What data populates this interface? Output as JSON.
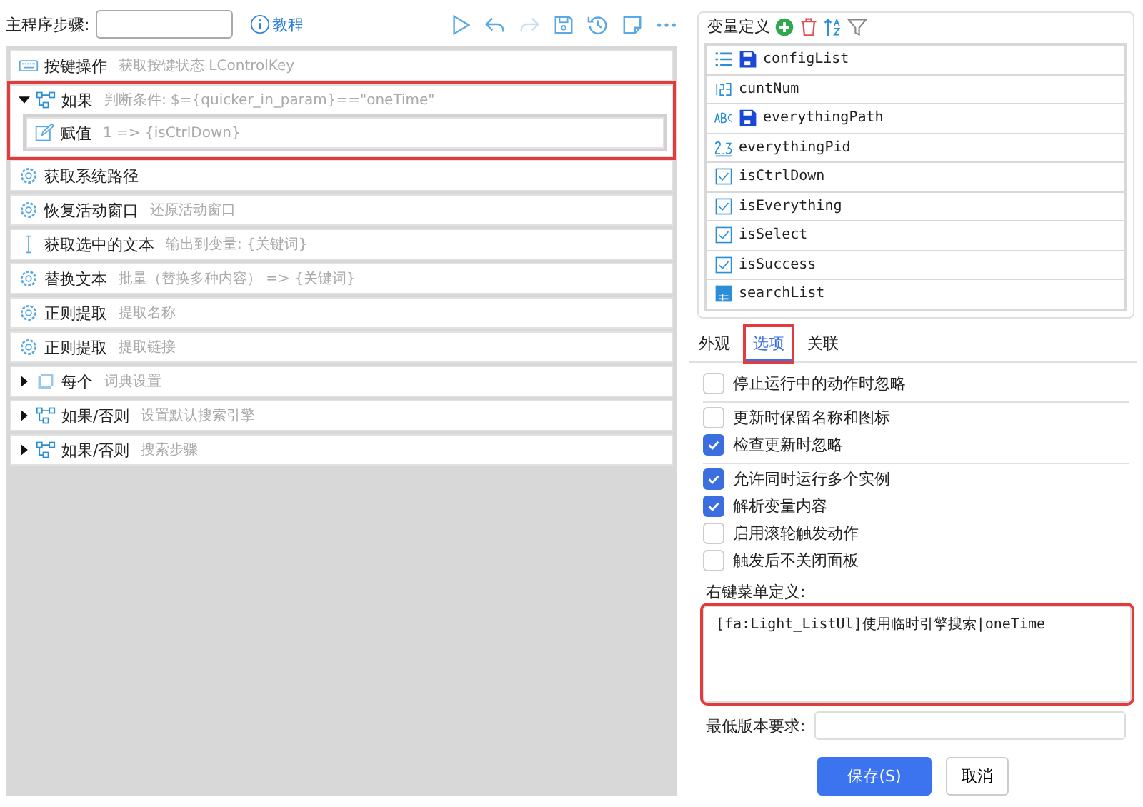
{
  "toolbar": {
    "label": "主程序步骤:",
    "help_link": "教程"
  },
  "steps": [
    {
      "kind": "keyboard",
      "title": "按键操作",
      "detail": "获取按键状态 LControlKey",
      "highlighted": false
    },
    {
      "kind": "branch",
      "title": "如果",
      "detail": "判断条件: $={quicker_in_param}==\"oneTime\"",
      "expanded": true,
      "highlighted": true,
      "children": [
        {
          "kind": "assign",
          "title": "赋值",
          "detail": "1 => {isCtrlDown}",
          "highlighted": false
        }
      ]
    },
    {
      "kind": "gear",
      "title": "获取系统路径",
      "highlighted": false
    },
    {
      "kind": "gear",
      "title": "恢复活动窗口",
      "detail": "还原活动窗口",
      "highlighted": false
    },
    {
      "kind": "cursor",
      "title": "获取选中的文本",
      "detail": "输出到变量: {关键词}",
      "highlighted": false
    },
    {
      "kind": "gear",
      "title": "替换文本",
      "detail": "批量（替换多种内容） => {关键词}",
      "highlighted": false
    },
    {
      "kind": "gear",
      "title": "正则提取",
      "detail": "提取名称",
      "highlighted": false
    },
    {
      "kind": "gear",
      "title": "正则提取",
      "detail": "提取链接",
      "highlighted": false
    },
    {
      "kind": "loop",
      "title": "每个",
      "detail": "词典设置",
      "expanded": false,
      "highlighted": false
    },
    {
      "kind": "branch",
      "title": "如果/否则",
      "detail": "设置默认搜索引擎",
      "expanded": false,
      "highlighted": false
    },
    {
      "kind": "branch",
      "title": "如果/否则",
      "detail": "搜索步骤",
      "expanded": false,
      "highlighted": false
    }
  ],
  "variables": {
    "title": "变量定义",
    "items": [
      {
        "kind": "list",
        "name": "configList",
        "saved": true
      },
      {
        "kind": "integer",
        "name": "cuntNum",
        "saved": false
      },
      {
        "kind": "text",
        "name": "everythingPath",
        "saved": true
      },
      {
        "kind": "decimal",
        "name": "everythingPid",
        "saved": false
      },
      {
        "kind": "boolean",
        "name": "isCtrlDown",
        "saved": false
      },
      {
        "kind": "boolean",
        "name": "isEverything",
        "saved": false
      },
      {
        "kind": "boolean",
        "name": "isSelect",
        "saved": false
      },
      {
        "kind": "boolean",
        "name": "isSuccess",
        "saved": false
      },
      {
        "kind": "table",
        "name": "searchList",
        "saved": false
      }
    ]
  },
  "tabs": [
    {
      "label": "外观",
      "selected": false,
      "highlighted": false
    },
    {
      "label": "选项",
      "selected": true,
      "highlighted": true
    },
    {
      "label": "关联",
      "selected": false,
      "highlighted": false
    }
  ],
  "option_groups": [
    [
      {
        "label": "停止运行中的动作时忽略",
        "checked": false
      }
    ],
    [
      {
        "label": "更新时保留名称和图标",
        "checked": false
      },
      {
        "label": "检查更新时忽略",
        "checked": true
      }
    ],
    [
      {
        "label": "允许同时运行多个实例",
        "checked": true
      },
      {
        "label": "解析变量内容",
        "checked": true
      },
      {
        "label": "启用滚轮触发动作",
        "checked": false
      },
      {
        "label": "触发后不关闭面板",
        "checked": false
      }
    ]
  ],
  "context_menu": {
    "label": "右键菜单定义:",
    "value": "[fa:Light_ListUl]使用临时引擎搜索|oneTime",
    "highlighted": true
  },
  "min_version": {
    "label": "最低版本要求:"
  },
  "buttons": [
    {
      "label": "保存(S)",
      "kind": "primary"
    },
    {
      "label": "取消",
      "kind": "secondary"
    }
  ]
}
